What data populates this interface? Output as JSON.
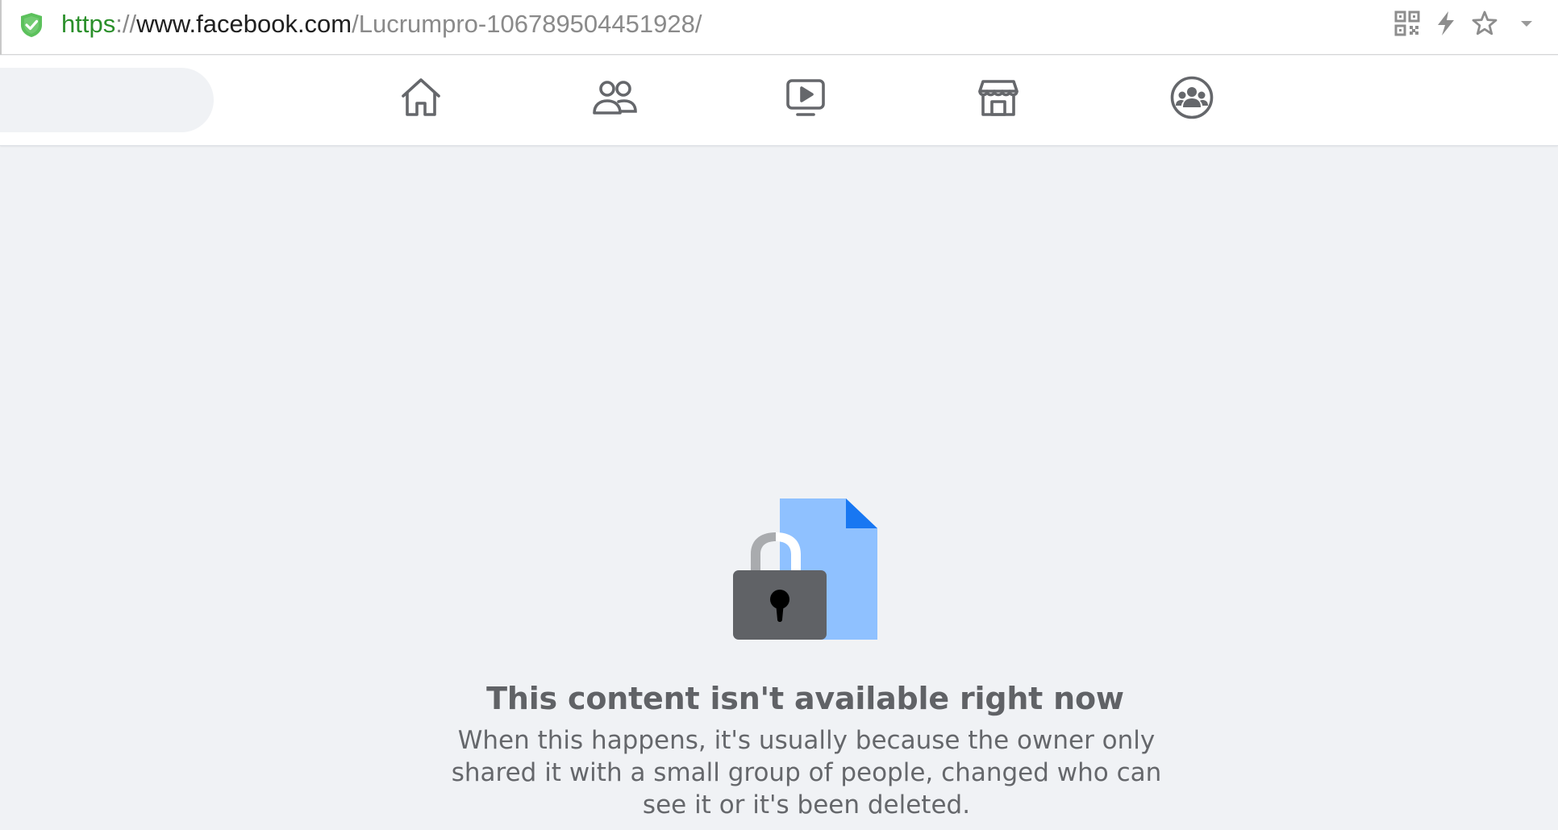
{
  "address_bar": {
    "url_protocol": "https",
    "url_separator": "://",
    "url_host": "www.facebook.com",
    "url_path": "/Lucrumpro-106789504451928/",
    "security_icon": "shield-check-icon",
    "right_icons": [
      "qr-code-icon",
      "lightning-icon",
      "star-icon",
      "chevron-down-icon"
    ]
  },
  "navbar": {
    "tabs": [
      {
        "name": "home",
        "icon": "home-icon"
      },
      {
        "name": "friends",
        "icon": "friends-icon"
      },
      {
        "name": "watch",
        "icon": "watch-icon"
      },
      {
        "name": "marketplace",
        "icon": "marketplace-icon"
      },
      {
        "name": "groups",
        "icon": "groups-icon"
      }
    ]
  },
  "content": {
    "illustration": "lock-document-icon",
    "title": "This content isn't available right now",
    "message": "When this happens, it's usually because the owner only shared it with a small group of people, changed who can see it or it's been deleted."
  },
  "colors": {
    "page_background": "#f0f2f5",
    "secure_green": "#2a8f2a",
    "shield_green": "#5cc15c",
    "doc_blue": "#8fc1ff",
    "doc_fold_blue": "#1877f2",
    "lock_gray": "#606266",
    "shackle_gray": "#a9abae",
    "title_gray": "#606266",
    "text_gray": "#65676b"
  }
}
